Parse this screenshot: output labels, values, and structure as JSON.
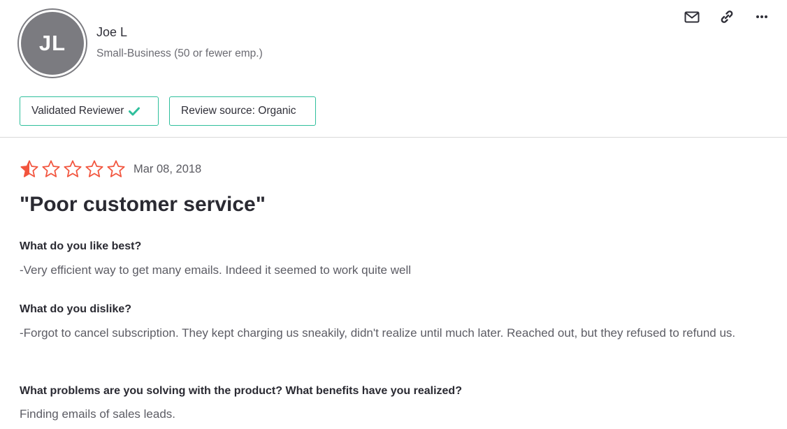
{
  "reviewer": {
    "initials": "JL",
    "name": "Joe L",
    "segment": "Small-Business (50 or fewer emp.)"
  },
  "actions": [
    {
      "icon": "envelope-icon"
    },
    {
      "icon": "link-icon"
    },
    {
      "icon": "more-horizontal-icon"
    }
  ],
  "badges": {
    "validated_label": "Validated Reviewer",
    "source_label": "Review source: Organic"
  },
  "colors": {
    "badge_border": "#2fbf9c",
    "check": "#2fbf9c",
    "star": "#f2543d",
    "avatar_bg": "#7b7b80"
  },
  "review": {
    "rating": 0.5,
    "max_rating": 5,
    "date": "Mar 08, 2018",
    "title": "\"Poor customer service\"",
    "sections": [
      {
        "question": "What do you like best?",
        "answer": "-Very efficient way to get many emails. Indeed it seemed to work quite well"
      },
      {
        "question": "What do you dislike?",
        "answer": "-Forgot to cancel subscription. They kept charging us sneakily, didn't realize until much later. Reached out, but they refused to refund us."
      },
      {
        "question": "What problems are you solving with the product? What benefits have you realized?",
        "answer": "Finding emails of sales leads."
      }
    ]
  }
}
